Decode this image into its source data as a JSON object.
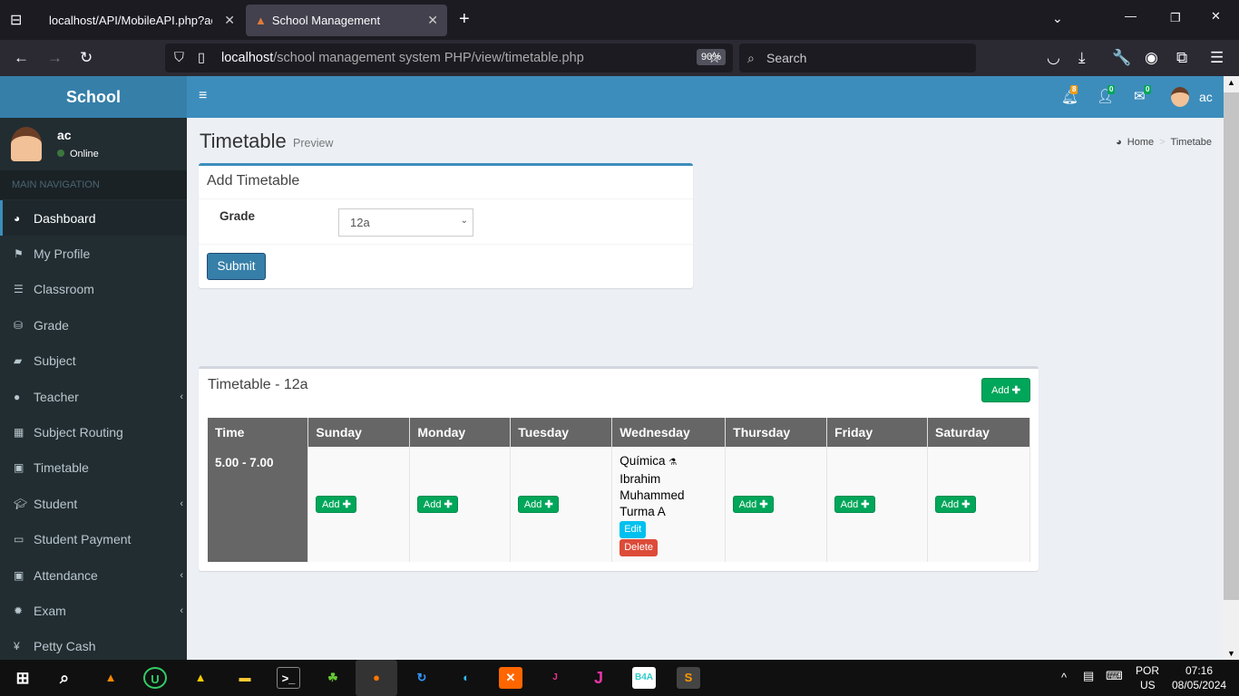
{
  "browser": {
    "tabs": [
      {
        "title": "localhost/API/MobileAPI.php?action"
      },
      {
        "title": "School Management"
      }
    ],
    "url_host": "localhost",
    "url_path": "/school management system PHP/view/timetable.php",
    "zoom": "90%",
    "search_placeholder": "Search"
  },
  "app": {
    "logo": "School",
    "user": "ac",
    "notifications": "8",
    "user_requests": "0",
    "messages": "0"
  },
  "sidebar": {
    "user": "ac",
    "status": "Online",
    "section": "MAIN NAVIGATION",
    "items": [
      {
        "label": "Dashboard",
        "icon": "dashboard-icon"
      },
      {
        "label": "My Profile",
        "icon": "flag-icon"
      },
      {
        "label": "Classroom",
        "icon": "list-icon"
      },
      {
        "label": "Grade",
        "icon": "database-icon"
      },
      {
        "label": "Subject",
        "icon": "book-icon"
      },
      {
        "label": "Teacher",
        "icon": "user-icon"
      },
      {
        "label": "Subject Routing",
        "icon": "grid-icon"
      },
      {
        "label": "Timetable",
        "icon": "calendar-plus-icon"
      },
      {
        "label": "Student",
        "icon": "graduation-cap-icon"
      },
      {
        "label": "Student Payment",
        "icon": "money-icon"
      },
      {
        "label": "Attendance",
        "icon": "calendar-check-icon"
      },
      {
        "label": "Exam",
        "icon": "gear-icon"
      },
      {
        "label": "Petty Cash",
        "icon": "yen-icon"
      }
    ]
  },
  "page": {
    "title": "Timetable",
    "subtitle": "Preview",
    "breadcrumb": [
      "Home",
      "Timetabe"
    ]
  },
  "form": {
    "title": "Add Timetable",
    "grade_label": "Grade",
    "grade_value": "12a",
    "submit": "Submit"
  },
  "timetable": {
    "title": "Timetable - 12a",
    "add": "Add",
    "headers": [
      "Time",
      "Sunday",
      "Monday",
      "Tuesday",
      "Wednesday",
      "Thursday",
      "Friday",
      "Saturday"
    ],
    "row": {
      "time": "5.00 - 7.00",
      "add": "Add",
      "wednesday": {
        "subject": "Química",
        "teacher1": "Ibrahim",
        "teacher2": "Muhammed",
        "class": "Turma A",
        "edit": "Edit",
        "delete": "Delete"
      }
    }
  },
  "taskbar": {
    "lang1": "POR",
    "lang2": "US",
    "time": "07:16",
    "date": "08/05/2024"
  }
}
